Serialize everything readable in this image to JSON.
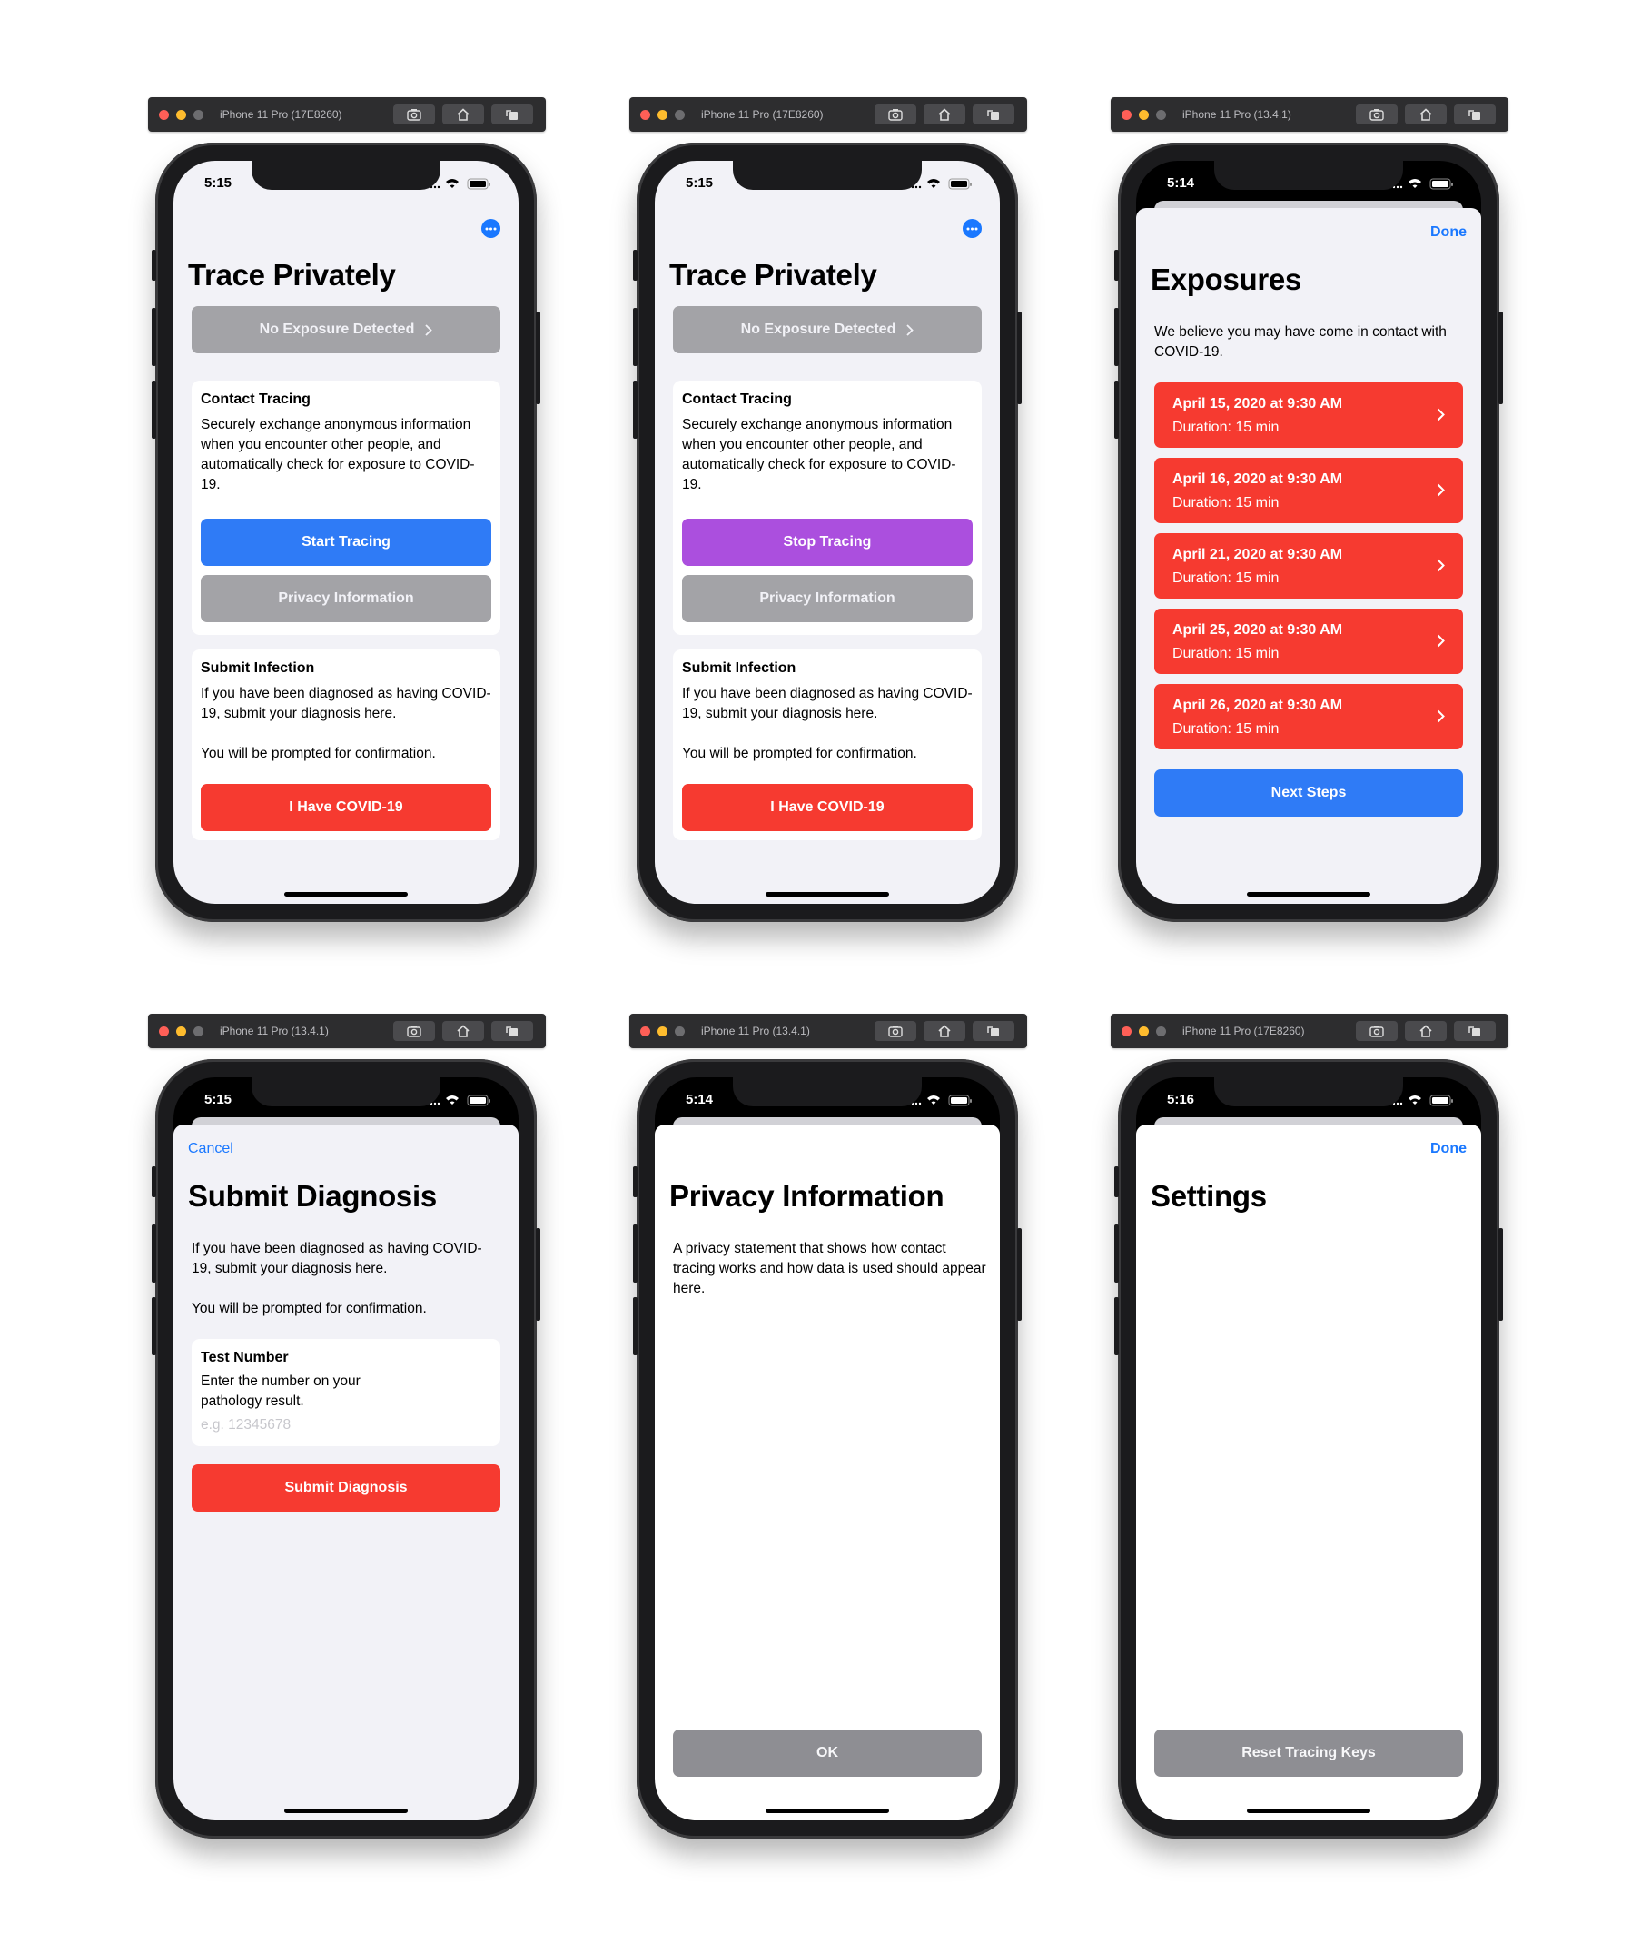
{
  "simulators": [
    {
      "title": "iPhone 11 Pro (17E8260)"
    },
    {
      "title": "iPhone 11 Pro (17E8260)"
    },
    {
      "title": "iPhone 11 Pro (13.4.1)"
    },
    {
      "title": "iPhone 11 Pro (13.4.1)"
    },
    {
      "title": "iPhone 11 Pro (13.4.1)"
    },
    {
      "title": "iPhone 11 Pro (17E8260)"
    }
  ],
  "home_tracing_off": {
    "time": "5:15",
    "title": "Trace Privately",
    "exposure_button": "No Exposure Detected",
    "contact": {
      "title": "Contact Tracing",
      "body": "Securely exchange anonymous information when you encounter other people, and automatically check for exposure to COVID-19.",
      "tracing_button": "Start Tracing",
      "privacy_button": "Privacy Information"
    },
    "submit": {
      "title": "Submit Infection",
      "body1": "If you have been diagnosed as having COVID-19, submit your diagnosis here.",
      "body2": "You will be prompted for confirmation.",
      "button": "I Have COVID-19"
    }
  },
  "home_tracing_on": {
    "time": "5:15",
    "title": "Trace Privately",
    "exposure_button": "No Exposure Detected",
    "contact": {
      "title": "Contact Tracing",
      "body": "Securely exchange anonymous information when you encounter other people, and automatically check for exposure to COVID-19.",
      "tracing_button": "Stop Tracing",
      "privacy_button": "Privacy Information"
    },
    "submit": {
      "title": "Submit Infection",
      "body1": "If you have been diagnosed as having COVID-19, submit your diagnosis here.",
      "body2": "You will be prompted for confirmation.",
      "button": "I Have COVID-19"
    }
  },
  "exposures": {
    "time": "5:14",
    "done": "Done",
    "title": "Exposures",
    "intro": "We believe you may have come in contact with COVID-19.",
    "items": [
      {
        "date": "April 15, 2020 at 9:30 AM",
        "duration": "Duration: 15 min"
      },
      {
        "date": "April 16, 2020 at 9:30 AM",
        "duration": "Duration: 15 min"
      },
      {
        "date": "April 21, 2020 at 9:30 AM",
        "duration": "Duration: 15 min"
      },
      {
        "date": "April 25, 2020 at 9:30 AM",
        "duration": "Duration: 15 min"
      },
      {
        "date": "April 26, 2020 at 9:30 AM",
        "duration": "Duration: 15 min"
      }
    ],
    "next_button": "Next Steps"
  },
  "submit_diagnosis": {
    "time": "5:15",
    "cancel": "Cancel",
    "title": "Submit Diagnosis",
    "body1": "If you have been diagnosed as having COVID-19, submit your diagnosis here.",
    "body2": "You will be prompted for confirmation.",
    "field_title": "Test Number",
    "field_desc": "Enter the number on your pathology result.",
    "field_placeholder": "e.g. 12345678",
    "button": "Submit Diagnosis"
  },
  "privacy": {
    "time": "5:14",
    "title": "Privacy Information",
    "body": "A privacy statement that shows how contact tracing works and how data is used should appear here.",
    "ok_button": "OK"
  },
  "settings": {
    "time": "5:16",
    "done": "Done",
    "title": "Settings",
    "reset_button": "Reset Tracing Keys"
  },
  "colors": {
    "accent_blue": "#2f7bf6",
    "alert_red": "#f63a30",
    "stop_purple": "#ab4fde",
    "disabled_gray": "#a3a3a7"
  }
}
